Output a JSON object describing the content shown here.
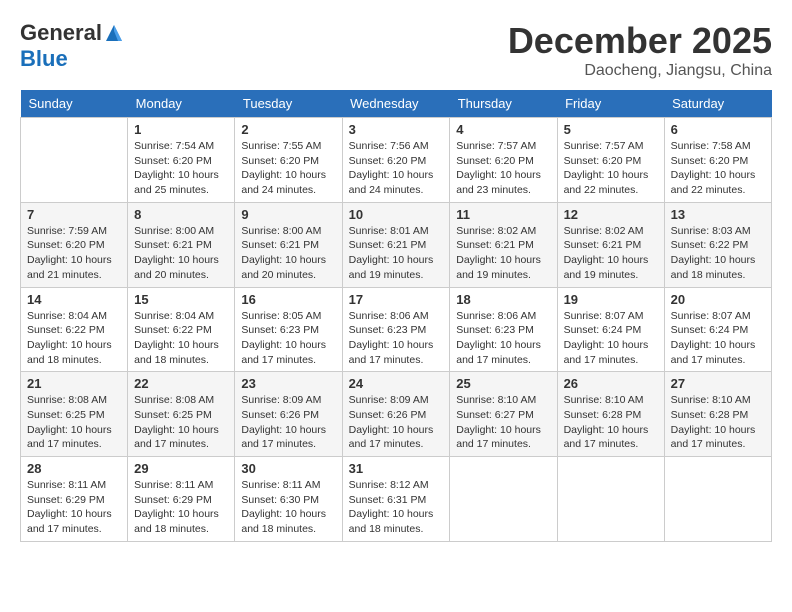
{
  "logo": {
    "general": "General",
    "blue": "Blue"
  },
  "title": {
    "month": "December 2025",
    "location": "Daocheng, Jiangsu, China"
  },
  "weekdays": [
    "Sunday",
    "Monday",
    "Tuesday",
    "Wednesday",
    "Thursday",
    "Friday",
    "Saturday"
  ],
  "weeks": [
    [
      {
        "day": "",
        "info": ""
      },
      {
        "day": "1",
        "info": "Sunrise: 7:54 AM\nSunset: 6:20 PM\nDaylight: 10 hours\nand 25 minutes."
      },
      {
        "day": "2",
        "info": "Sunrise: 7:55 AM\nSunset: 6:20 PM\nDaylight: 10 hours\nand 24 minutes."
      },
      {
        "day": "3",
        "info": "Sunrise: 7:56 AM\nSunset: 6:20 PM\nDaylight: 10 hours\nand 24 minutes."
      },
      {
        "day": "4",
        "info": "Sunrise: 7:57 AM\nSunset: 6:20 PM\nDaylight: 10 hours\nand 23 minutes."
      },
      {
        "day": "5",
        "info": "Sunrise: 7:57 AM\nSunset: 6:20 PM\nDaylight: 10 hours\nand 22 minutes."
      },
      {
        "day": "6",
        "info": "Sunrise: 7:58 AM\nSunset: 6:20 PM\nDaylight: 10 hours\nand 22 minutes."
      }
    ],
    [
      {
        "day": "7",
        "info": "Sunrise: 7:59 AM\nSunset: 6:20 PM\nDaylight: 10 hours\nand 21 minutes."
      },
      {
        "day": "8",
        "info": "Sunrise: 8:00 AM\nSunset: 6:21 PM\nDaylight: 10 hours\nand 20 minutes."
      },
      {
        "day": "9",
        "info": "Sunrise: 8:00 AM\nSunset: 6:21 PM\nDaylight: 10 hours\nand 20 minutes."
      },
      {
        "day": "10",
        "info": "Sunrise: 8:01 AM\nSunset: 6:21 PM\nDaylight: 10 hours\nand 19 minutes."
      },
      {
        "day": "11",
        "info": "Sunrise: 8:02 AM\nSunset: 6:21 PM\nDaylight: 10 hours\nand 19 minutes."
      },
      {
        "day": "12",
        "info": "Sunrise: 8:02 AM\nSunset: 6:21 PM\nDaylight: 10 hours\nand 19 minutes."
      },
      {
        "day": "13",
        "info": "Sunrise: 8:03 AM\nSunset: 6:22 PM\nDaylight: 10 hours\nand 18 minutes."
      }
    ],
    [
      {
        "day": "14",
        "info": "Sunrise: 8:04 AM\nSunset: 6:22 PM\nDaylight: 10 hours\nand 18 minutes."
      },
      {
        "day": "15",
        "info": "Sunrise: 8:04 AM\nSunset: 6:22 PM\nDaylight: 10 hours\nand 18 minutes."
      },
      {
        "day": "16",
        "info": "Sunrise: 8:05 AM\nSunset: 6:23 PM\nDaylight: 10 hours\nand 17 minutes."
      },
      {
        "day": "17",
        "info": "Sunrise: 8:06 AM\nSunset: 6:23 PM\nDaylight: 10 hours\nand 17 minutes."
      },
      {
        "day": "18",
        "info": "Sunrise: 8:06 AM\nSunset: 6:23 PM\nDaylight: 10 hours\nand 17 minutes."
      },
      {
        "day": "19",
        "info": "Sunrise: 8:07 AM\nSunset: 6:24 PM\nDaylight: 10 hours\nand 17 minutes."
      },
      {
        "day": "20",
        "info": "Sunrise: 8:07 AM\nSunset: 6:24 PM\nDaylight: 10 hours\nand 17 minutes."
      }
    ],
    [
      {
        "day": "21",
        "info": "Sunrise: 8:08 AM\nSunset: 6:25 PM\nDaylight: 10 hours\nand 17 minutes."
      },
      {
        "day": "22",
        "info": "Sunrise: 8:08 AM\nSunset: 6:25 PM\nDaylight: 10 hours\nand 17 minutes."
      },
      {
        "day": "23",
        "info": "Sunrise: 8:09 AM\nSunset: 6:26 PM\nDaylight: 10 hours\nand 17 minutes."
      },
      {
        "day": "24",
        "info": "Sunrise: 8:09 AM\nSunset: 6:26 PM\nDaylight: 10 hours\nand 17 minutes."
      },
      {
        "day": "25",
        "info": "Sunrise: 8:10 AM\nSunset: 6:27 PM\nDaylight: 10 hours\nand 17 minutes."
      },
      {
        "day": "26",
        "info": "Sunrise: 8:10 AM\nSunset: 6:28 PM\nDaylight: 10 hours\nand 17 minutes."
      },
      {
        "day": "27",
        "info": "Sunrise: 8:10 AM\nSunset: 6:28 PM\nDaylight: 10 hours\nand 17 minutes."
      }
    ],
    [
      {
        "day": "28",
        "info": "Sunrise: 8:11 AM\nSunset: 6:29 PM\nDaylight: 10 hours\nand 17 minutes."
      },
      {
        "day": "29",
        "info": "Sunrise: 8:11 AM\nSunset: 6:29 PM\nDaylight: 10 hours\nand 18 minutes."
      },
      {
        "day": "30",
        "info": "Sunrise: 8:11 AM\nSunset: 6:30 PM\nDaylight: 10 hours\nand 18 minutes."
      },
      {
        "day": "31",
        "info": "Sunrise: 8:12 AM\nSunset: 6:31 PM\nDaylight: 10 hours\nand 18 minutes."
      },
      {
        "day": "",
        "info": ""
      },
      {
        "day": "",
        "info": ""
      },
      {
        "day": "",
        "info": ""
      }
    ]
  ]
}
